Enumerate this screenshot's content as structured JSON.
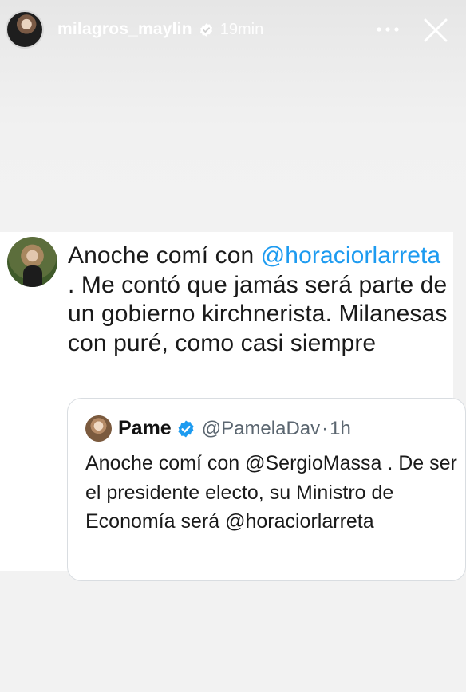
{
  "story": {
    "username": "milagros_maylin",
    "time": "19min",
    "more_label": "•••",
    "close_label": "✕"
  },
  "tweet": {
    "line_parts": {
      "p1": "Anoche comí con ",
      "mention": "@horaciorlarreta",
      "p2": " . Me contó que jamás será parte de un gobierno kirchnerista. Milanesas con puré, como casi siempre"
    }
  },
  "quote": {
    "name": "Pame",
    "handle": "@PamelaDav",
    "separator": "·",
    "time": "1h",
    "text": "Anoche comí con @SergioMassa . De ser el presidente electo, su Ministro de Economía será @horaciorlarreta"
  },
  "colors": {
    "mention": "#1d9bf0",
    "verified": "#1d9bf0"
  },
  "icons": {
    "verified": "verified-badge-icon",
    "more": "more-options-icon",
    "close": "close-icon"
  }
}
